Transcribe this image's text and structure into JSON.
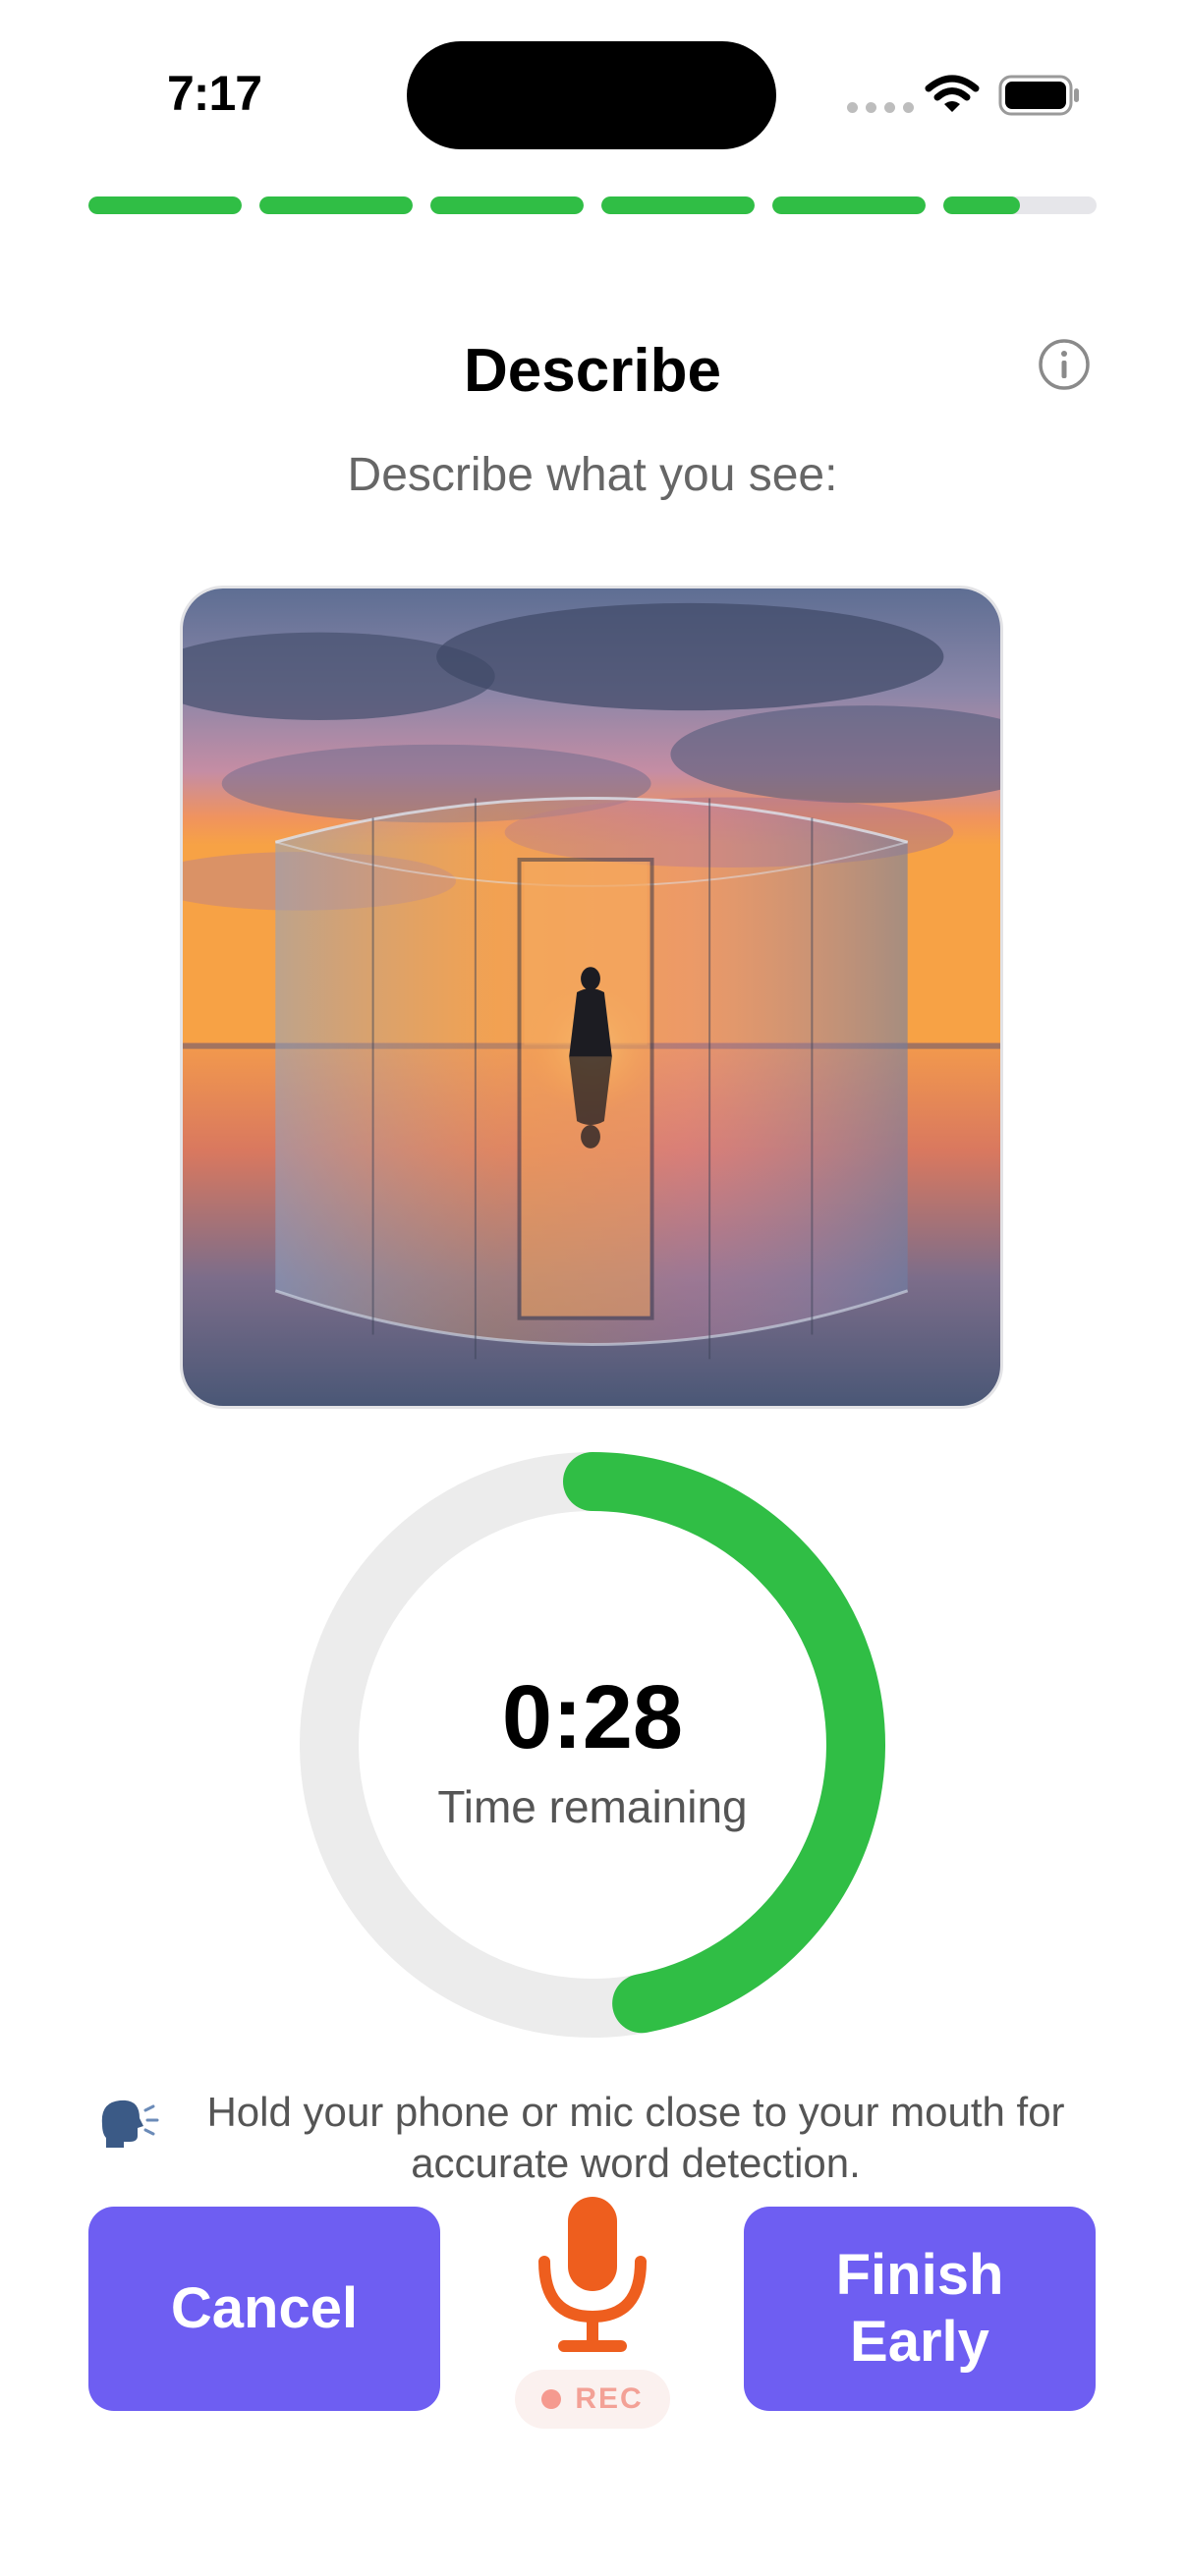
{
  "status_bar": {
    "time": "7:17",
    "icons": [
      "signal-dots-icon",
      "wifi-icon",
      "battery-icon"
    ]
  },
  "progress": {
    "total_steps": 6,
    "completed_steps": 5,
    "current_step_fraction": 0.5,
    "color_complete": "#30BE45",
    "color_track": "#E6E6EA"
  },
  "header": {
    "title": "Describe",
    "info_icon": "info-circle-icon",
    "subtitle": "Describe what you see:"
  },
  "picture": {
    "subject": "silhouette of a person standing in a doorway of a circular glass wall at sunset, reflected on water"
  },
  "timer": {
    "value": "0:28",
    "label": "Time remaining",
    "remaining_fraction": 0.47,
    "color_ring": "#30BE45",
    "color_track": "#ECECEC"
  },
  "hint": {
    "icon": "speaking-head-icon",
    "text": "Hold your phone or mic close to your mouth for accurate word detection."
  },
  "controls": {
    "cancel_label": "Cancel",
    "finish_label": "Finish\nEarly",
    "mic_icon": "microphone-icon",
    "rec_label": "REC",
    "accent_color": "#6E5EF2",
    "mic_color": "#EE5E1E"
  }
}
